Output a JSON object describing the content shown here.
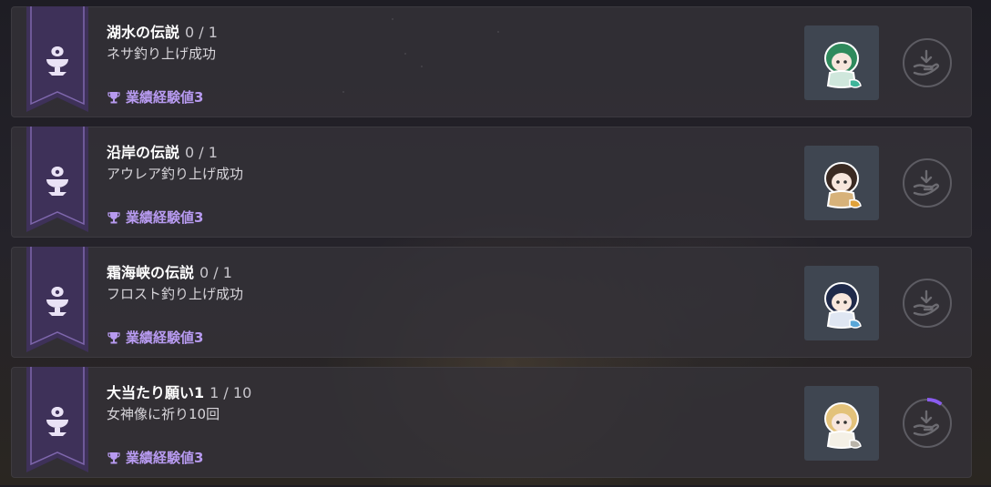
{
  "achievements": [
    {
      "name": "湖水の伝説",
      "progress": "0 / 1",
      "description": "ネサ釣り上げ成功",
      "reward": "業績経験値3",
      "portrait_icon": "green-haired-chibi-character",
      "claim_icon": "hand-receive-icon",
      "progress_fraction": 0
    },
    {
      "name": "沿岸の伝説",
      "progress": "0 / 1",
      "description": "アウレア釣り上げ成功",
      "reward": "業績経験値3",
      "portrait_icon": "dark-haired-chibi-character",
      "claim_icon": "hand-receive-icon",
      "progress_fraction": 0
    },
    {
      "name": "霜海峡の伝説",
      "progress": "0 / 1",
      "description": "フロスト釣り上げ成功",
      "reward": "業績経験値3",
      "portrait_icon": "navy-haired-chibi-character",
      "claim_icon": "hand-receive-icon",
      "progress_fraction": 0
    },
    {
      "name": "大当たり願い1",
      "progress": "1 / 10",
      "description": "女神像に祈り10回",
      "reward": "業績経験値3",
      "portrait_icon": "blonde-haired-chibi-character",
      "claim_icon": "hand-receive-icon",
      "progress_fraction": 0.1
    }
  ],
  "colors": {
    "banner_purple": "#4a3a66",
    "reward_purple": "#b79af0",
    "progress_ring": "#8a5cf0"
  }
}
